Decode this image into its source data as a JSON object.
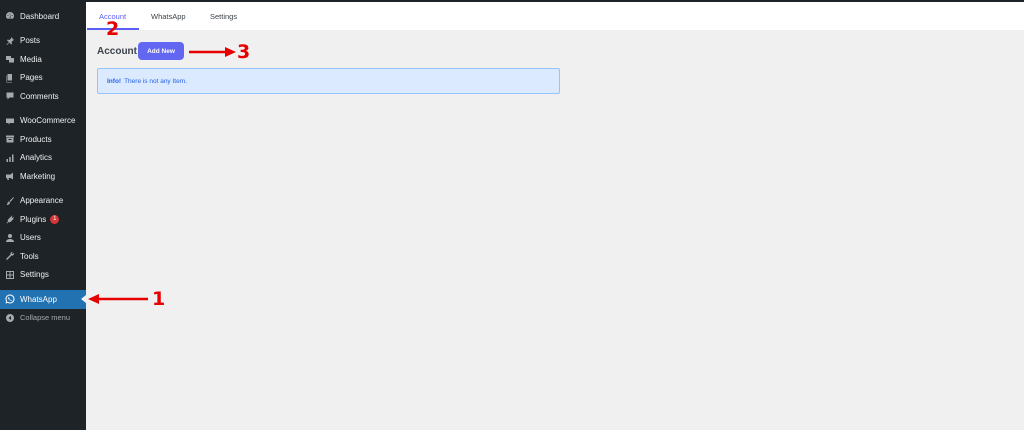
{
  "sidebar": {
    "items": [
      {
        "label": "Dashboard",
        "icon": "dashboard-icon"
      },
      {
        "label": "Posts",
        "icon": "pin-icon"
      },
      {
        "label": "Media",
        "icon": "media-icon"
      },
      {
        "label": "Pages",
        "icon": "pages-icon"
      },
      {
        "label": "Comments",
        "icon": "comment-icon"
      },
      {
        "label": "WooCommerce",
        "icon": "woocommerce-icon"
      },
      {
        "label": "Products",
        "icon": "archive-icon"
      },
      {
        "label": "Analytics",
        "icon": "bar-chart-icon"
      },
      {
        "label": "Marketing",
        "icon": "megaphone-icon"
      },
      {
        "label": "Appearance",
        "icon": "brush-icon"
      },
      {
        "label": "Plugins",
        "icon": "plug-icon",
        "badge": "1"
      },
      {
        "label": "Users",
        "icon": "user-icon"
      },
      {
        "label": "Tools",
        "icon": "wrench-icon"
      },
      {
        "label": "Settings",
        "icon": "settings-icon"
      },
      {
        "label": "WhatsApp",
        "icon": "whatsapp-icon",
        "active": true
      },
      {
        "label": "Collapse menu",
        "icon": "collapse-icon"
      }
    ],
    "active_color": "#2271b1",
    "background": "#1d2327"
  },
  "tabs": [
    {
      "label": "Account",
      "active": true
    },
    {
      "label": "WhatsApp"
    },
    {
      "label": "Settings"
    }
  ],
  "main": {
    "title": "Account",
    "add_button_label": "Add New",
    "info": {
      "strong": "Info!",
      "text": "There is not any Item."
    },
    "accent_color": "#6366f1"
  },
  "annotations": {
    "one": "1",
    "two": "2",
    "three": "3",
    "color": "#e60000"
  }
}
